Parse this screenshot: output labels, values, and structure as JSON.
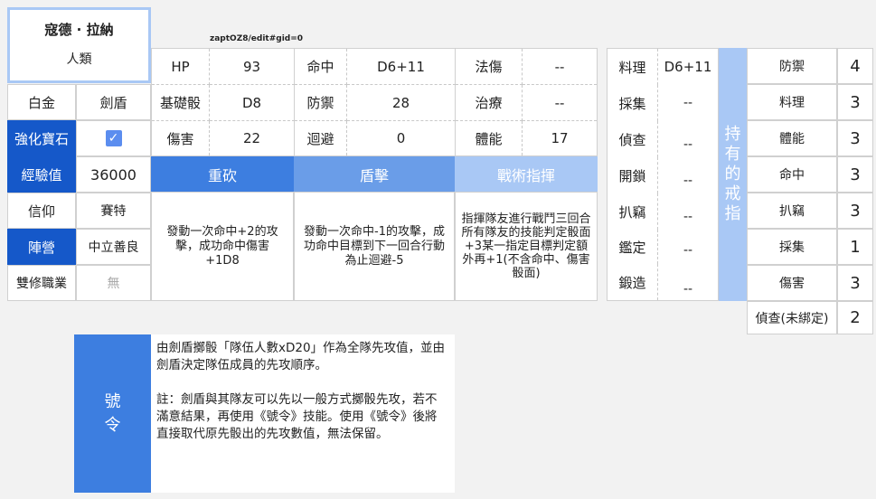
{
  "character": {
    "name": "寇德 · 拉納",
    "race": "人類"
  },
  "sheet_link": "zaptOZ8/edit#gid=0",
  "left": {
    "rank_label": "白金",
    "class_label": "劍盾",
    "gem_label": "強化寶石",
    "gem_checked": true,
    "exp_label": "經驗值",
    "exp_value": "36000",
    "faith_label": "信仰",
    "faith_value": "賽特",
    "alignment_label": "陣營",
    "alignment_value": "中立善良",
    "dual_label": "雙修職業",
    "dual_value": "無"
  },
  "stats": [
    [
      {
        "label": "HP",
        "value": "93"
      },
      {
        "label": "命中",
        "value": "D6+11"
      },
      {
        "label": "法傷",
        "value": "--"
      }
    ],
    [
      {
        "label": "基礎骰",
        "value": "D8"
      },
      {
        "label": "防禦",
        "value": "28"
      },
      {
        "label": "治療",
        "value": "--"
      }
    ],
    [
      {
        "label": "傷害",
        "value": "22"
      },
      {
        "label": "迴避",
        "value": "0"
      },
      {
        "label": "體能",
        "value": "17"
      }
    ]
  ],
  "skills": [
    {
      "name": "重砍",
      "color": "#3d7ee0",
      "desc": "發動一次命中+2的攻擊，成功命中傷害+1D8"
    },
    {
      "name": "盾擊",
      "color": "#6a9de8",
      "desc": "發動一次命中-1的攻擊，成功命中目標到下一回合行動為止迴避-5"
    },
    {
      "name": "戰術指揮",
      "color": "#a9c8f5",
      "desc": "指揮隊友進行戰鬥三回合所有隊友的技能判定骰面+3某一指定目標判定額外再+1(不含命中、傷害骰面)"
    }
  ],
  "crafts": [
    {
      "label": "料理",
      "value": "D6+11"
    },
    {
      "label": "採集",
      "value": "--"
    },
    {
      "label": "偵查",
      "value": "--"
    },
    {
      "label": "開鎖",
      "value": "--"
    },
    {
      "label": "扒竊",
      "value": "--"
    },
    {
      "label": "鑑定",
      "value": "--"
    },
    {
      "label": "鍛造",
      "value": "--"
    }
  ],
  "rings_label": "持有的戒指",
  "rings": [
    {
      "label": "防禦",
      "value": "4"
    },
    {
      "label": "料理",
      "value": "3"
    },
    {
      "label": "體能",
      "value": "3"
    },
    {
      "label": "命中",
      "value": "3"
    },
    {
      "label": "扒竊",
      "value": "3"
    },
    {
      "label": "採集",
      "value": "1"
    },
    {
      "label": "傷害",
      "value": "3"
    },
    {
      "label": "偵查(未綁定)",
      "value": "2"
    }
  ],
  "command": {
    "label": "號令",
    "text1": "由劍盾擲骰「隊伍人數xD20」作為全隊先攻值，並由劍盾決定隊伍成員的先攻順序。",
    "text2": "註：劍盾與其隊友可以先以一般方式擲骰先攻，若不滿意結果，再使用《號令》技能。使用《號令》後將直接取代原先骰出的先攻數值，無法保留。"
  }
}
